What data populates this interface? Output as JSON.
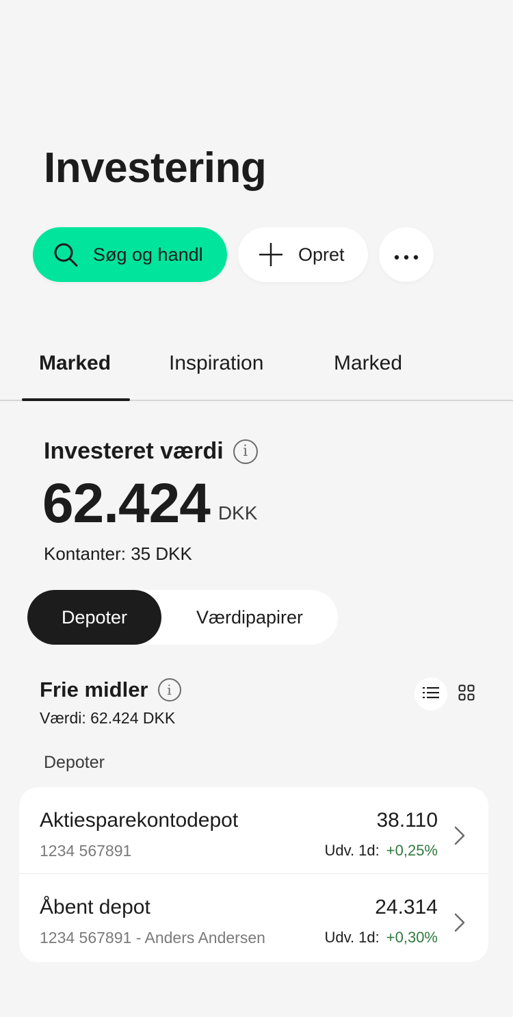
{
  "page": {
    "title": "Investering"
  },
  "actions": {
    "search_label": "Søg og handl",
    "create_label": "Opret",
    "more_label": "•••",
    "search_color": "#00e59b"
  },
  "tabs": [
    {
      "label": "Marked",
      "active": true
    },
    {
      "label": "Inspiration",
      "active": false
    },
    {
      "label": "Marked",
      "active": false
    }
  ],
  "summary": {
    "heading": "Investeret værdi",
    "info": "i",
    "value": "62.424",
    "currency": "DKK",
    "cash": "Kontanter: 35 DKK"
  },
  "segments": [
    {
      "label": "Depoter",
      "active": true
    },
    {
      "label": "Værdipapirer",
      "active": false
    }
  ],
  "free_funds": {
    "heading": "Frie midler",
    "info": "i",
    "value_text": "Værdi: 62.424 DKK",
    "view_modes": [
      "list-view-icon",
      "grid-view-icon"
    ],
    "active_view": "list"
  },
  "depots": {
    "section_label": "Depoter",
    "items": [
      {
        "name": "Aktiesparekontodepot",
        "account": "1234 567891",
        "amount": "38.110",
        "change_label": "Udv. 1d:",
        "change_value": "+0,25%"
      },
      {
        "name": "Åbent depot",
        "account": "1234 567891 - Anders Andersen",
        "amount": "24.314",
        "change_label": "Udv. 1d:",
        "change_value": "+0,30%"
      }
    ],
    "positive_color": "#2f7a3f"
  }
}
